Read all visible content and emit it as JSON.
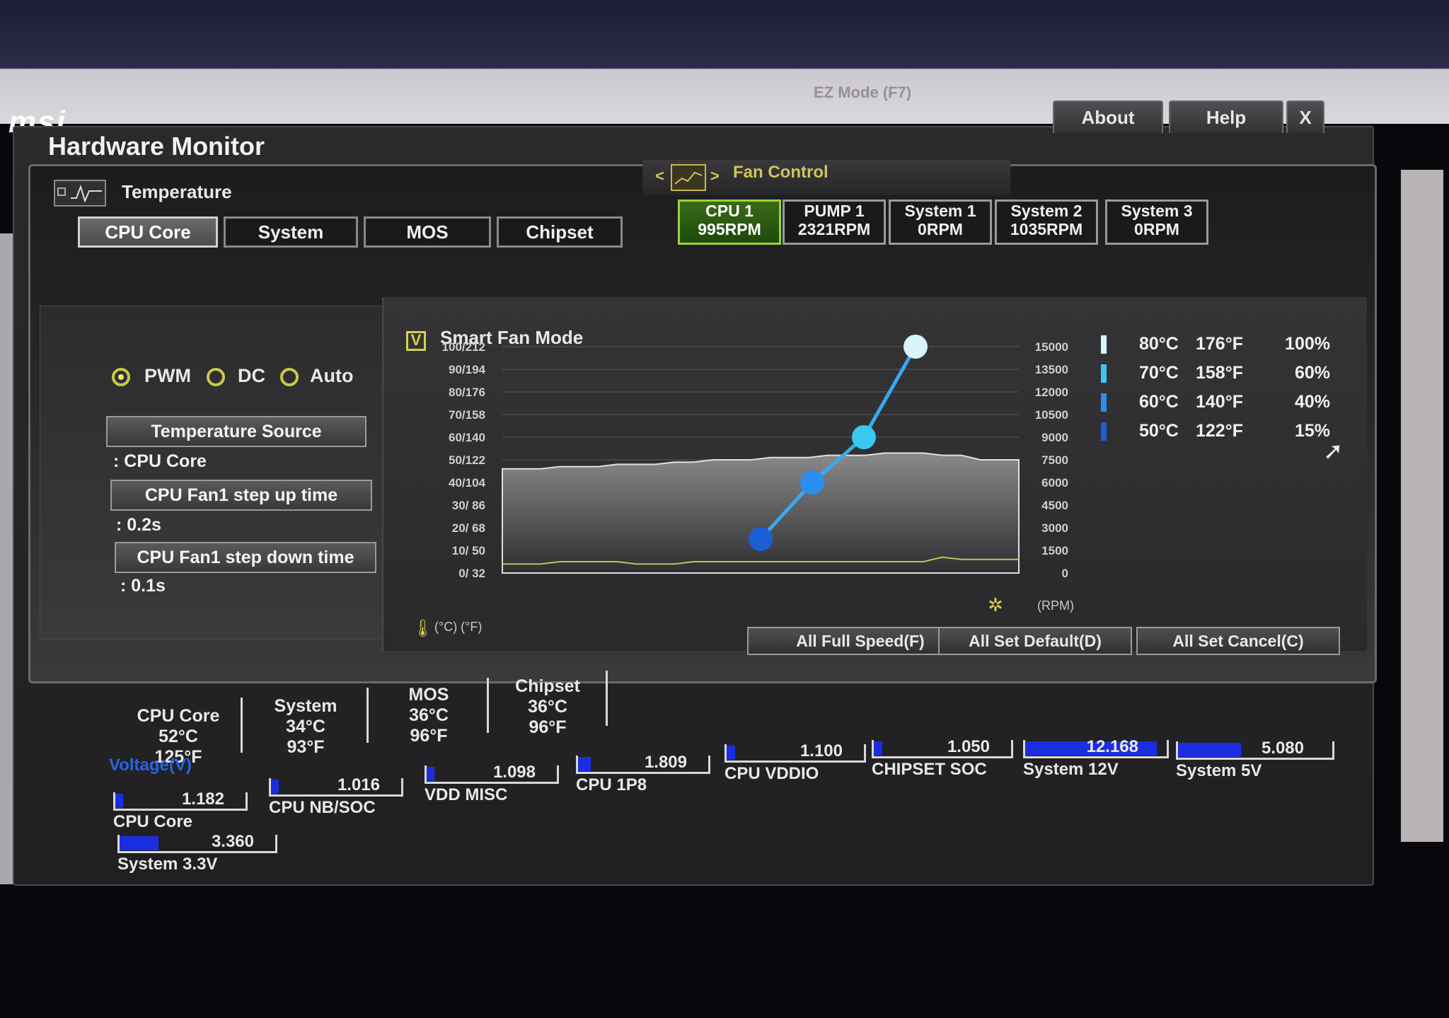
{
  "banner": {
    "logo_text": "msi",
    "ez_mode_label": "EZ Mode (F7)"
  },
  "window": {
    "title": "Hardware Monitor",
    "about_label": "About",
    "help_label": "Help",
    "close_label": "X"
  },
  "temperature": {
    "header": "Temperature",
    "tabs": [
      {
        "label": "CPU Core",
        "active": true
      },
      {
        "label": "System",
        "active": false
      },
      {
        "label": "MOS",
        "active": false
      },
      {
        "label": "Chipset",
        "active": false
      }
    ]
  },
  "fan_control": {
    "header": "Fan Control",
    "prev_label": "<",
    "next_label": ">",
    "fans": [
      {
        "name": "CPU 1",
        "rpm": "995RPM",
        "active": true
      },
      {
        "name": "PUMP 1",
        "rpm": "2321RPM",
        "active": false
      },
      {
        "name": "System 1",
        "rpm": "0RPM",
        "active": false
      },
      {
        "name": "System 2",
        "rpm": "1035RPM",
        "active": false
      },
      {
        "name": "System 3",
        "rpm": "0RPM",
        "active": false
      }
    ]
  },
  "controls": {
    "modes": [
      {
        "label": "PWM",
        "selected": true
      },
      {
        "label": "DC",
        "selected": false
      },
      {
        "label": "Auto",
        "selected": false
      }
    ],
    "temp_source_label": "Temperature Source",
    "temp_source_value": ": CPU Core",
    "step_up_label": "CPU Fan1 step up time",
    "step_up_value": ": 0.2s",
    "step_down_label": "CPU Fan1 step down time",
    "step_down_value": ": 0.1s"
  },
  "smart_fan": {
    "label": "Smart Fan Mode",
    "checked": true,
    "check_mark": "V"
  },
  "chart_data": {
    "type": "line",
    "left_ticks": [
      "100/212",
      "90/194",
      "80/176",
      "70/158",
      "60/140",
      "50/122",
      "40/104",
      "30/ 86",
      "20/ 68",
      "10/ 50",
      "0/ 32"
    ],
    "right_ticks": [
      "15000",
      "13500",
      "12000",
      "10500",
      "9000",
      "7500",
      "6000",
      "4500",
      "3000",
      "1500",
      "0"
    ],
    "unit_left": "(°C)  (°F)",
    "unit_right": "(RPM)",
    "fan_curve": {
      "x_temp_c": [
        50,
        60,
        70,
        80
      ],
      "y_percent": [
        15,
        40,
        60,
        100
      ],
      "colors": [
        "#1a5fd6",
        "#2a8ff0",
        "#3ac8f0",
        "#d8f4fa"
      ]
    },
    "temperature_history_pct_of_range": [
      46,
      46,
      46,
      47,
      47,
      47,
      48,
      48,
      48,
      49,
      49,
      50,
      50,
      50,
      51,
      51,
      51,
      52,
      52,
      52,
      53,
      53,
      53,
      52,
      52,
      50,
      50,
      50
    ],
    "rpm_history_pct_of_range": [
      4,
      4,
      4,
      5,
      5,
      5,
      5,
      4,
      4,
      4,
      5,
      5,
      5,
      5,
      5,
      5,
      5,
      5,
      5,
      5,
      5,
      5,
      5,
      7,
      6,
      6,
      6,
      6
    ]
  },
  "legend": [
    {
      "c": "80°C",
      "f": "176°F",
      "pct": "100%",
      "color": "#d8f4fa"
    },
    {
      "c": "70°C",
      "f": "158°F",
      "pct": "60%",
      "color": "#3ac8f0"
    },
    {
      "c": "60°C",
      "f": "140°F",
      "pct": "40%",
      "color": "#2a8ff0"
    },
    {
      "c": "50°C",
      "f": "122°F",
      "pct": "15%",
      "color": "#1a5fd6"
    }
  ],
  "actions": {
    "full_speed": "All Full Speed(F)",
    "set_default": "All Set Default(D)",
    "set_cancel": "All Set Cancel(C)"
  },
  "summary": [
    {
      "name": "CPU Core",
      "c": "52°C",
      "f": "125°F"
    },
    {
      "name": "System",
      "c": "34°C",
      "f": "93°F"
    },
    {
      "name": "MOS",
      "c": "36°C",
      "f": "96°F"
    },
    {
      "name": "Chipset",
      "c": "36°C",
      "f": "96°F"
    }
  ],
  "voltage": {
    "title": "Voltage(V)",
    "items": [
      {
        "name": "CPU Core",
        "value": "1.182",
        "level": 0.06
      },
      {
        "name": "CPU NB/SOC",
        "value": "1.016",
        "level": 0.06
      },
      {
        "name": "VDD MISC",
        "value": "1.098",
        "level": 0.06
      },
      {
        "name": "CPU 1P8",
        "value": "1.809",
        "level": 0.1
      },
      {
        "name": "CPU VDDIO",
        "value": "1.100",
        "level": 0.06
      },
      {
        "name": "CHIPSET SOC",
        "value": "1.050",
        "level": 0.06
      },
      {
        "name": "System 12V",
        "value": "12.168",
        "level": 0.93
      },
      {
        "name": "System 5V",
        "value": "5.080",
        "level": 0.41
      },
      {
        "name": "System 3.3V",
        "value": "3.360",
        "level": 0.25
      }
    ]
  },
  "colors": {
    "accent_yellow": "#d6d04a",
    "active_green": "#9ad23a",
    "voltage_blue": "#1a2ee0",
    "voltage_title": "#2a62e8"
  }
}
